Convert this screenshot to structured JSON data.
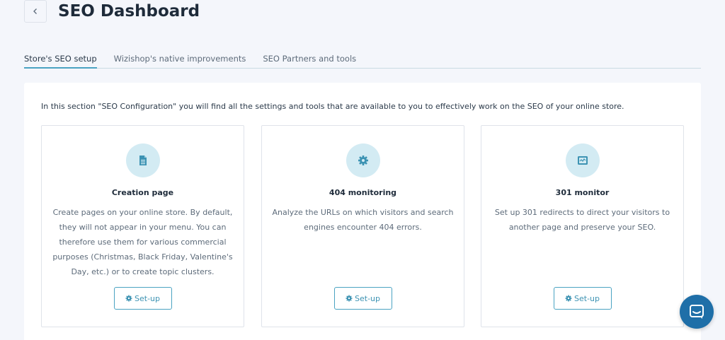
{
  "header": {
    "title": "SEO Dashboard"
  },
  "tabs": [
    {
      "label": "Store's SEO setup",
      "active": true
    },
    {
      "label": "Wizishop's native improvements",
      "active": false
    },
    {
      "label": "SEO Partners and tools",
      "active": false
    }
  ],
  "panel": {
    "intro": "In this section \"SEO Configuration\" you will find all the settings and tools that are available to you to effectively work on the SEO of your online store."
  },
  "cards": [
    {
      "icon": "document-icon",
      "title": "Creation page",
      "description": "Create pages on your online store. By default, they will not appear in your menu. You can therefore use them for various commercial purposes (Christmas, Black Friday, Valentine's Day, etc.) or to create topic clusters.",
      "button": "Set-up"
    },
    {
      "icon": "gear-icon",
      "title": "404 monitoring",
      "description": "Analyze the URLs on which visitors and search engines encounter 404 errors.",
      "button": "Set-up"
    },
    {
      "icon": "monitor-icon",
      "title": "301 monitor",
      "description": "Set up 301 redirects to direct your visitors to another page and preserve your SEO.",
      "button": "Set-up"
    }
  ],
  "colors": {
    "accent": "#4aa3c2",
    "icon_bg": "#d3ebf3",
    "chat": "#1f6fa8"
  }
}
